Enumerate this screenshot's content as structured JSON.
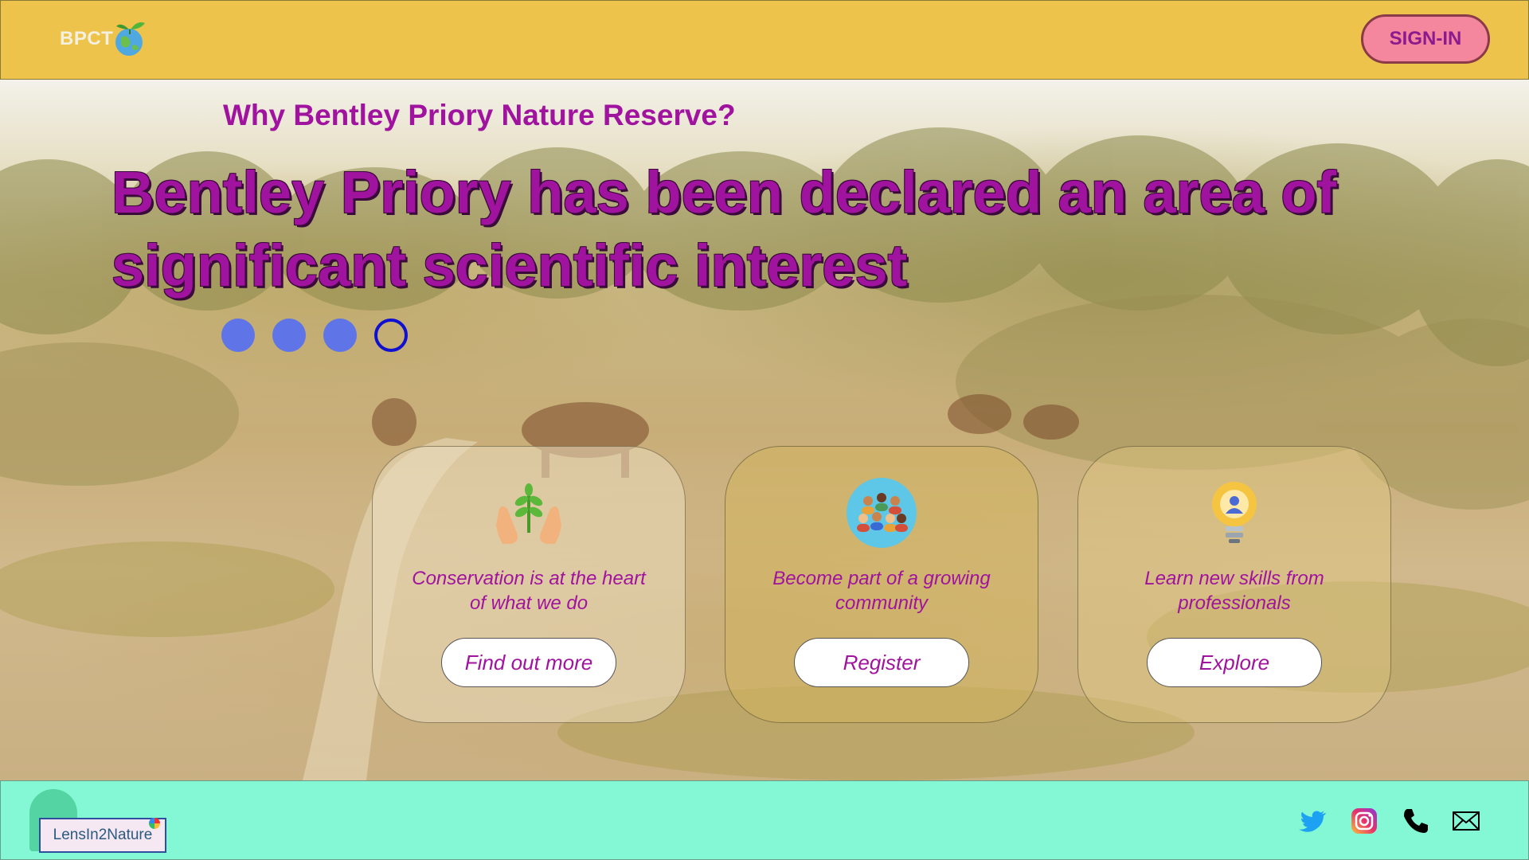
{
  "header": {
    "brand": "BPCT",
    "signin_label": "SIGN-IN"
  },
  "hero": {
    "subtitle": "Why Bentley Priory Nature Reserve?",
    "headline": "Bentley Priory has been declared an area of significant scientific interest",
    "carousel": {
      "total": 4,
      "active_index": 4
    }
  },
  "cards": [
    {
      "icon": "hands-plant-icon",
      "text": "Conservation is at the heart of what we do",
      "button": "Find out more"
    },
    {
      "icon": "community-icon",
      "text": "Become part of a growing community",
      "button": "Register"
    },
    {
      "icon": "lightbulb-icon",
      "text": "Learn new skills from professionals",
      "button": "Explore"
    }
  ],
  "footer": {
    "logo_text": "LensIn2Nature",
    "socials": [
      "twitter-icon",
      "instagram-icon",
      "phone-icon",
      "mail-icon"
    ]
  },
  "colors": {
    "header_bg": "#eec34c",
    "footer_bg": "#84f7d4",
    "accent_text": "#a0139e",
    "signin_bg": "#f4869d",
    "dot": "#5f74e6",
    "dot_active": "#1010d0"
  }
}
